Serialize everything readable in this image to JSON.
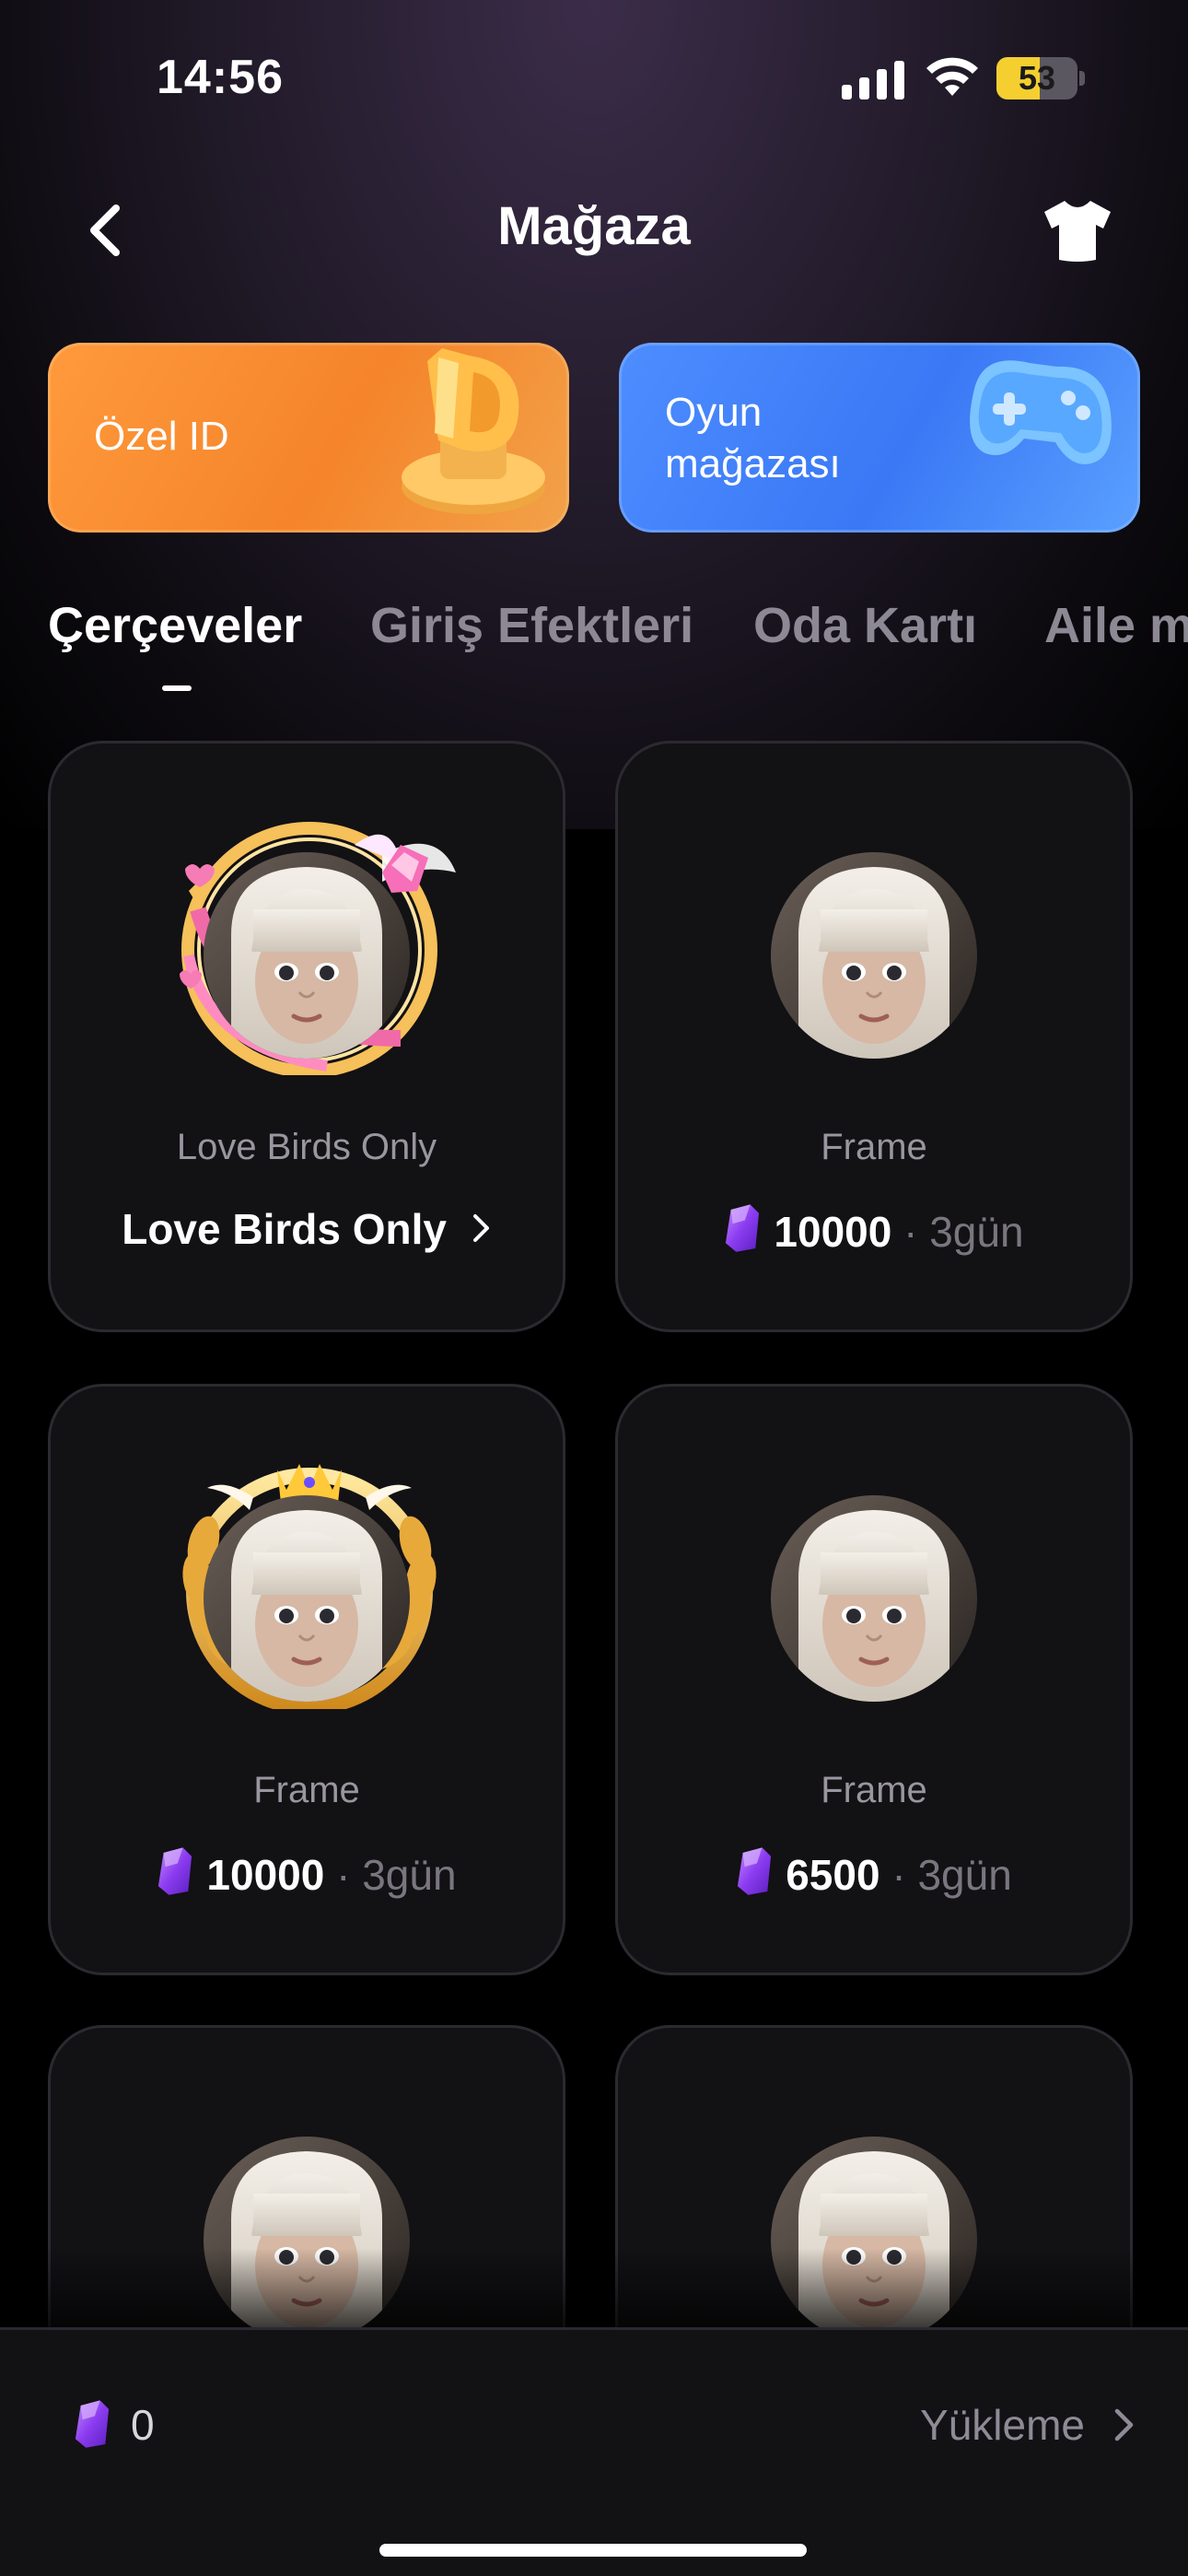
{
  "status_bar": {
    "time": "14:56",
    "battery": "53",
    "battery_level": 0.53
  },
  "header": {
    "title": "Mağaza",
    "back_icon": "chevron-left-icon",
    "right_icon": "tshirt-icon"
  },
  "banners": [
    {
      "label": "Özel ID",
      "icon": "id-badge-icon",
      "color": "#f5842a"
    },
    {
      "label": "Oyun\nmağazası",
      "label_line1": "Oyun",
      "label_line2": "mağazası",
      "icon": "gamepad-icon",
      "color": "#3a78f5"
    }
  ],
  "tabs": [
    {
      "label": "Çerçeveler",
      "active": true
    },
    {
      "label": "Giriş Efektleri",
      "active": false
    },
    {
      "label": "Oda Kartı",
      "active": false
    },
    {
      "label": "Aile m",
      "active": false
    }
  ],
  "items": [
    {
      "name": "Love Birds Only",
      "action_label": "Love Birds Only",
      "frame": "pink-heart-frame"
    },
    {
      "name": "Frame",
      "price": "10000",
      "duration": " · 3gün",
      "frame": "none"
    },
    {
      "name": "Frame",
      "price": "10000",
      "duration": " · 3gün",
      "frame": "gold-laurel-crown-frame"
    },
    {
      "name": "Frame",
      "price": "6500",
      "duration": " · 3gün",
      "frame": "none"
    },
    {
      "name": "",
      "frame": "none"
    },
    {
      "name": "",
      "frame": "none"
    }
  ],
  "footer": {
    "balance": "0",
    "topup_label": "Yükleme",
    "currency_icon": "purple-gem-icon"
  },
  "colors": {
    "background": "#000000",
    "card": "#121114",
    "gem": "#8b3cf0",
    "accent_orange": "#f5842a",
    "accent_blue": "#3a78f5"
  }
}
